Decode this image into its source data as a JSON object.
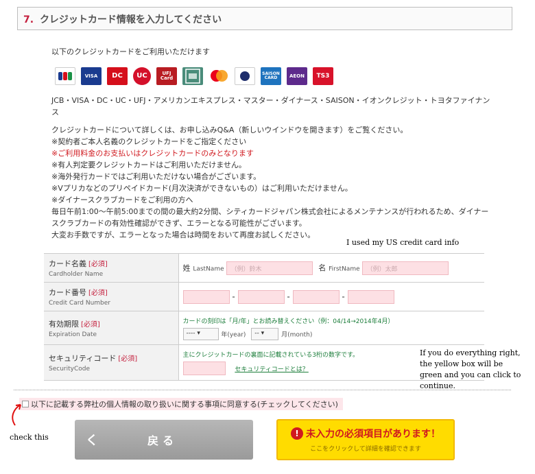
{
  "section": {
    "number": "7.",
    "title": "クレジットカード情報を入力してください"
  },
  "intro": "以下のクレジットカードをご利用いただけます",
  "brands": {
    "jcb": "JCB",
    "visa": "VISA",
    "dc": "DC",
    "uc": "UC",
    "ufj": "UFJ Card",
    "diners": "Diners Club International",
    "saison": "SAISON CARD",
    "aeon": "AEON",
    "ts3": "TS3"
  },
  "card_list": "JCB・VISA・DC・UC・UFJ・アメリカンエキスプレス・マスター・ダイナース・SAISON・イオンクレジット・トヨタファイナンス",
  "notes": [
    "クレジットカードについて詳しくは、お申し込みQ&A（新しいウインドウを開きます）をご覧ください。",
    "※契約者ご本人名義のクレジットカードをご指定ください",
    "※ご利用料金のお支払いはクレジットカードのみとなります",
    "※有人判定要クレジットカードはご利用いただけません。",
    "※海外発行カードではご利用いただけない場合がございます。",
    "※Vプリカなどのプリペイドカード(月次決済ができないもの）はご利用いただけません。",
    "※ダイナースクラブカードをご利用の方へ",
    "毎日午前1:00〜午前5:00までの間の最大約2分間、シティカードジャパン株式会社によるメンテナンスが行われるため、ダイナースクラブカードの有効性確認ができず、エラーとなる可能性がございます。",
    "大変お手数ですが、エラーとなった場合は時間をおいて再度お試しください。"
  ],
  "annotations": {
    "us_card": "I used my US credit card info",
    "yellow_box": "If you do everything right, the yellow box will be green and you can click to continue.",
    "check_this": "check this"
  },
  "form": {
    "required": "[必須]",
    "cardholder": {
      "label": "カード名義",
      "label_en": "Cardholder Name",
      "last_prefix": "姓",
      "last_label": "LastName",
      "last_placeholder": "（例）鈴木",
      "first_prefix": "名",
      "first_label": "FirstName",
      "first_placeholder": "（例）太郎"
    },
    "card_number": {
      "label": "カード番号",
      "label_en": "Credit Card Number",
      "separator": "-"
    },
    "expiration": {
      "label": "有効期限",
      "label_en": "Expiration Date",
      "hint": "カードの刻印は「月/年」とお読み替えください（例：04/14→2014年4月）",
      "year_value": "----",
      "year_unit": "年(year)",
      "month_value": "--",
      "month_unit": "月(month)"
    },
    "security": {
      "label": "セキュリティコード",
      "label_en": "SecurityCode",
      "hint": "主にクレジットカードの裏面に記載されている3桁の数字です。",
      "link": "セキュリティコードとは？"
    }
  },
  "agree_text": "以下に記載する弊社の個人情報の取り扱いに関する事項に同意する(チェックしてください)",
  "buttons": {
    "back_arrow": "く",
    "back": "戻る",
    "warn_icon": "!",
    "warn_main": "未入力の必須項目があります！",
    "warn_sub": "ここをクリックして詳細を確認できます"
  },
  "colors": {
    "accent": "#c41f3d",
    "warning_bg": "#ffdc00",
    "input_bg": "#fde0e4",
    "note_red": "#d0191f"
  }
}
